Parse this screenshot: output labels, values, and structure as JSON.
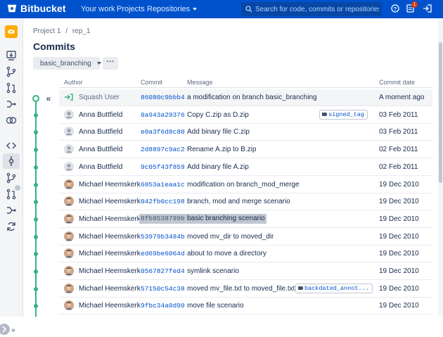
{
  "app": {
    "name": "Bitbucket"
  },
  "nav": {
    "your_work": "Your work",
    "projects": "Projects",
    "repositories": "Repositories"
  },
  "search": {
    "placeholder": "Search for code, commits or repositories..."
  },
  "notifications": {
    "count": "1"
  },
  "breadcrumb": {
    "project": "Project 1",
    "sep": "/",
    "repo": "rep_1"
  },
  "page": {
    "title": "Commits"
  },
  "branch": {
    "name": "basic_branching"
  },
  "more_label": "···",
  "collapse_label": "«",
  "columns": {
    "author": "Author",
    "commit": "Commit",
    "message": "Message",
    "date": "Commit date"
  },
  "commits": [
    {
      "author": "Squash User",
      "hash": "86080c9bbb4",
      "message": "a modification on branch basic_branching",
      "date": "A moment ago",
      "avatar": "squash"
    },
    {
      "author": "Anna Buttfield",
      "hash": "0a943a29376",
      "message": "Copy C.zip as D.zip",
      "date": "03 Feb 2011",
      "avatar": "anna",
      "tag": "signed_tag"
    },
    {
      "author": "Anna Buttfield",
      "hash": "e0a3f6d8c80",
      "message": "Add binary file C.zip",
      "date": "03 Feb 2011",
      "avatar": "anna"
    },
    {
      "author": "Anna Buttfield",
      "hash": "2d8897c9ac2",
      "message": "Rename A.zip to B.zip",
      "date": "02 Feb 2011",
      "avatar": "anna"
    },
    {
      "author": "Anna Buttfield",
      "hash": "9c05f43f859",
      "message": "Add binary file A.zip",
      "date": "02 Feb 2011",
      "avatar": "anna"
    },
    {
      "author": "Michael Heemskerk",
      "hash": "6053a1eaa1c",
      "message": "modification on branch_mod_merge",
      "date": "19 Dec 2010",
      "avatar": "michael"
    },
    {
      "author": "Michael Heemskerk",
      "hash": "042fb0cc198",
      "message": "branch, mod and merge scenario",
      "date": "19 Dec 2010",
      "avatar": "michael"
    },
    {
      "author": "Michael Heemskerk",
      "hash": "8fb8538799b",
      "message": "basic branching scenario",
      "date": "19 Dec 2010",
      "avatar": "michael",
      "selected": true
    },
    {
      "author": "Michael Heemskerk",
      "hash": "53979b3484b",
      "message": "moved mv_dir to moved_dir",
      "date": "19 Dec 2010",
      "avatar": "michael"
    },
    {
      "author": "Michael Heemskerk",
      "hash": "ed69be6064d",
      "message": "about to move a directory",
      "date": "19 Dec 2010",
      "avatar": "michael"
    },
    {
      "author": "Michael Heemskerk",
      "hash": "0567827fed4",
      "message": "symlink scenario",
      "date": "19 Dec 2010",
      "avatar": "michael"
    },
    {
      "author": "Michael Heemskerk",
      "hash": "57150c54c38",
      "message": "moved mv_file.txt to moved_file.txt",
      "date": "19 Dec 2010",
      "avatar": "michael",
      "tag": "backdated_annot..."
    },
    {
      "author": "Michael Heemskerk",
      "hash": "9fbc34a0d90",
      "message": "move file scenario",
      "date": "19 Dec 2010",
      "avatar": "michael"
    }
  ],
  "colors": {
    "brand": "#0052cc",
    "graph": "#36b37e",
    "repo_avatar": "#ffab00"
  }
}
